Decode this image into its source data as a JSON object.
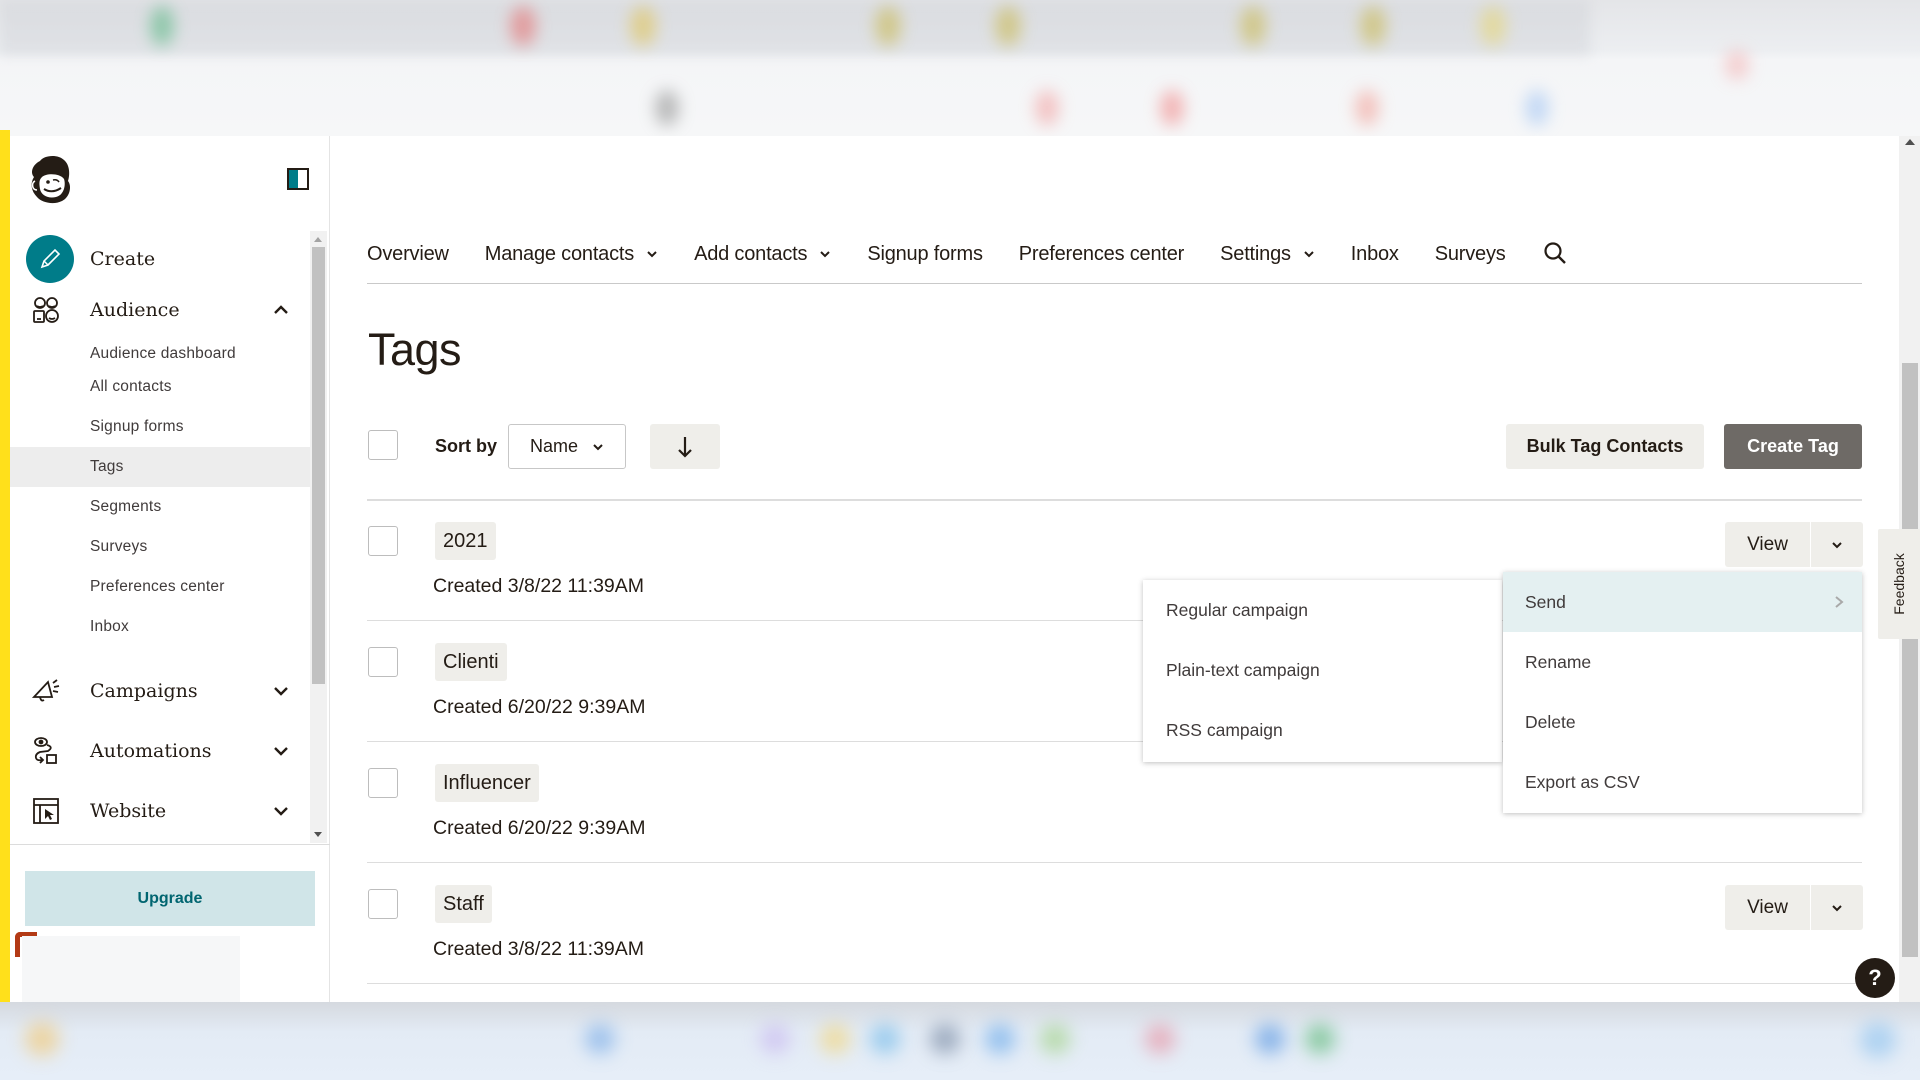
{
  "sidebar": {
    "create_label": "Create",
    "audience": {
      "label": "Audience",
      "expanded": true,
      "items": [
        {
          "label": "Audience dashboard",
          "active": false
        },
        {
          "label": "All contacts",
          "active": false
        },
        {
          "label": "Signup forms",
          "active": false
        },
        {
          "label": "Tags",
          "active": true
        },
        {
          "label": "Segments",
          "active": false
        },
        {
          "label": "Surveys",
          "active": false
        },
        {
          "label": "Preferences center",
          "active": false
        },
        {
          "label": "Inbox",
          "active": false
        }
      ]
    },
    "sections": [
      {
        "label": "Campaigns",
        "icon": "megaphone-icon"
      },
      {
        "label": "Automations",
        "icon": "automation-flow-icon"
      },
      {
        "label": "Website",
        "icon": "website-cursor-icon"
      }
    ],
    "upgrade_label": "Upgrade"
  },
  "topnav": {
    "items": [
      {
        "label": "Overview",
        "dropdown": false
      },
      {
        "label": "Manage contacts",
        "dropdown": true
      },
      {
        "label": "Add contacts",
        "dropdown": true
      },
      {
        "label": "Signup forms",
        "dropdown": false
      },
      {
        "label": "Preferences center",
        "dropdown": false
      },
      {
        "label": "Settings",
        "dropdown": true
      },
      {
        "label": "Inbox",
        "dropdown": false
      },
      {
        "label": "Surveys",
        "dropdown": false
      }
    ]
  },
  "page": {
    "title": "Tags",
    "sort_by_label": "Sort by",
    "sort_value": "Name",
    "sort_direction": "descending",
    "bulk_tag_label": "Bulk Tag Contacts",
    "create_tag_label": "Create Tag"
  },
  "tags": [
    {
      "name": "2021",
      "created": "Created 3/8/22 11:39AM"
    },
    {
      "name": "Clienti",
      "created": "Created 6/20/22 9:39AM"
    },
    {
      "name": "Influencer",
      "created": "Created 6/20/22 9:39AM"
    },
    {
      "name": "Staff",
      "created": "Created 3/8/22 11:39AM"
    }
  ],
  "row_actions": {
    "view_label": "View"
  },
  "actions_menu": {
    "items": [
      {
        "label": "Send",
        "has_submenu": true,
        "highlighted": true
      },
      {
        "label": "Rename",
        "has_submenu": false,
        "highlighted": false
      },
      {
        "label": "Delete",
        "has_submenu": false,
        "highlighted": false
      },
      {
        "label": "Export as CSV",
        "has_submenu": false,
        "highlighted": false
      }
    ]
  },
  "send_submenu": {
    "items": [
      {
        "label": "Regular campaign"
      },
      {
        "label": "Plain-text campaign"
      },
      {
        "label": "RSS campaign"
      }
    ]
  },
  "feedback_label": "Feedback",
  "help_label": "?",
  "colors": {
    "brand_yellow": "#ffe01b",
    "teal": "#007c89",
    "upgrade_bg": "#d0e5e8",
    "menu_highlight": "#e4f0f1",
    "primary_button": "#6e6a66",
    "secondary_button": "#efeeea"
  }
}
